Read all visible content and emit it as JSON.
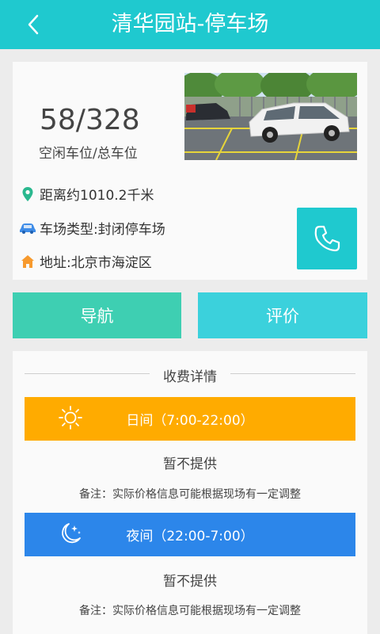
{
  "header": {
    "title": "清华园站-停车场",
    "back_icon": "chevron-left-icon",
    "background": "#1fc9cf"
  },
  "parking": {
    "count": "58/328",
    "count_label": "空闲车位/总车位",
    "distance": "距离约1010.2千米",
    "type": "车场类型:封闭停车场",
    "address": "地址:北京市海淀区",
    "icons": {
      "distance": "location-pin-icon",
      "type": "car-icon",
      "address": "home-icon",
      "phone": "phone-icon"
    }
  },
  "actions": {
    "navigate": "导航",
    "rate": "评价"
  },
  "fees": {
    "title": "收费详情",
    "day": {
      "label": "日间（7:00-22:00）",
      "price": "暂不提供",
      "note": "备注：实际价格信息可能根据现场有一定调整",
      "color": "#ffab00",
      "icon": "sun-icon"
    },
    "night": {
      "label": "夜间（22:00-7:00）",
      "price": "暂不提供",
      "note": "备注：实际价格信息可能根据现场有一定调整",
      "color": "#2c86ea",
      "icon": "moon-stars-icon"
    }
  }
}
